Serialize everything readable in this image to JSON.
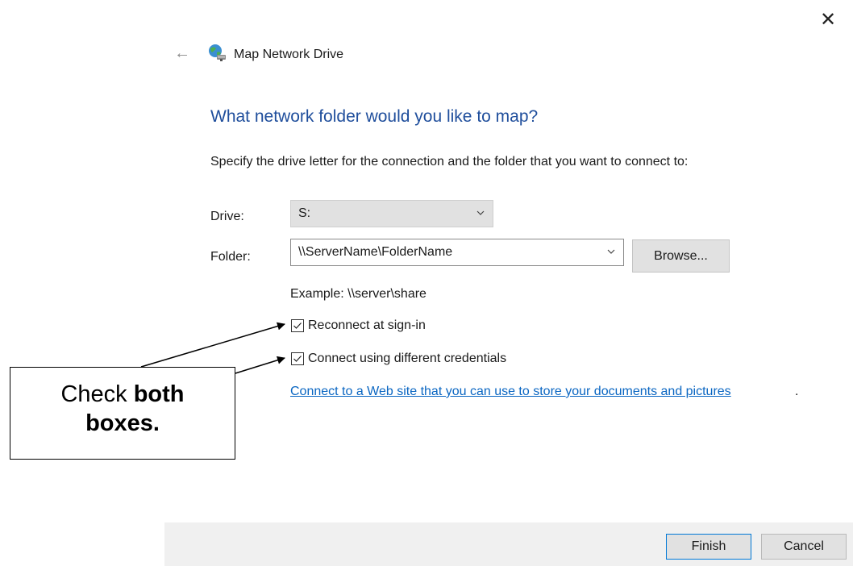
{
  "window": {
    "title": "Map Network Drive",
    "close_glyph": "✕",
    "back_glyph": "←",
    "icon": "network-drive-icon"
  },
  "main": {
    "heading": "What network folder would you like to map?",
    "instructions": "Specify the drive letter for the connection and the folder that you want to connect to:",
    "drive": {
      "label": "Drive:",
      "value": "S:"
    },
    "folder": {
      "label": "Folder:",
      "value": "\\\\ServerName\\FolderName",
      "browse_label": "Browse..."
    },
    "example": "Example: \\\\server\\share",
    "checkboxes": [
      {
        "label": "Reconnect at sign-in",
        "checked": true
      },
      {
        "label": "Connect using different credentials",
        "checked": true
      }
    ],
    "web_link": "Connect to a Web site that you can use to store your documents and pictures",
    "web_link_suffix": "."
  },
  "callout": {
    "prefix": "Check ",
    "bold1": "both",
    "bold2": "boxes."
  },
  "footer": {
    "finish_label": "Finish",
    "cancel_label": "Cancel"
  },
  "colors": {
    "heading": "#1f4e9c",
    "link": "#0a66c2",
    "accent_border": "#0078d7"
  }
}
